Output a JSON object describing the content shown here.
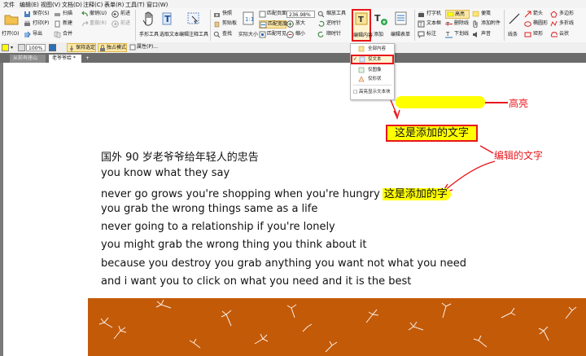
{
  "menu": {
    "items": [
      "文件",
      "编辑(E)",
      "视图(V)",
      "文档(D)",
      "注释(C)",
      "表单(R)",
      "工具(T)",
      "窗口(W)"
    ]
  },
  "ribbon": {
    "open": "打开(O)",
    "save_as": "保存(S)",
    "print": "打印(P)",
    "export": "导出",
    "scan": "扫描",
    "new": "新建",
    "merge": "合并",
    "undo": "撤销(U)",
    "redo": "重做(R)",
    "back": "前进",
    "forward": "前进",
    "hand_tool": "手形工具",
    "select_text": "选取文本",
    "edit_annot": "编辑注释工具",
    "snapshot": "快照",
    "clipboard": "剪贴板",
    "find": "查找",
    "actual_size": "实际大小",
    "fit_page": "匹配页面",
    "fit_width": "匹配宽度",
    "fit_visible": "匹配可见",
    "zoom_value": "236.98%",
    "zoom_in": "放大",
    "zoom_out": "缩小",
    "zoom_tool": "缩放工具",
    "rotate_left": "逆时针",
    "rotate_right": "顺时针",
    "edit_content": "编辑内容",
    "add": "添加",
    "edit_form": "编辑表单",
    "typewriter": "打字机",
    "textbox": "文本框",
    "callout": "标注",
    "highlight": "高亮",
    "strikeout": "删除线",
    "underline": "下划线",
    "note": "便笺",
    "attach": "添加附件",
    "sound": "声音",
    "line": "线条",
    "arrow": "箭头",
    "ellipse": "椭圆形",
    "rectangle": "矩形",
    "polygon": "多边形",
    "polyline": "多折线",
    "cloud": "云状"
  },
  "toolbar2": {
    "zoom": "100%",
    "keep_selected": "保持选定",
    "exclusive_mode": "独占模式",
    "properties": "属性(P)..."
  },
  "tabs": [
    {
      "label": "从前有座山"
    },
    {
      "label": "老爷爷给 *"
    }
  ],
  "dropdown": {
    "items": [
      "全部内容",
      "仅文本",
      "仅图像",
      "仅形状",
      "高亮显示文本块"
    ]
  },
  "document": {
    "lines": [
      "国外 90 岁老爷爷给年轻人的忠告",
      "you know what they say",
      "never go grows you're shopping when you're hungry",
      "you grab the wrong things same as a life",
      "never going to a relationship if you're lonely",
      "you might grab the wrong thing you think about it",
      "because you destroy you grab anything you want not what you need",
      "and i want you to click on what you need and it is the best"
    ],
    "inline_highlight": "这是添加的字",
    "added_text": "这是添加的文字"
  },
  "annotations": {
    "highlight_label": "高亮",
    "edit_text_label": "编辑的文字"
  },
  "colors": {
    "accent_red": "#e8161b",
    "highlight_yellow": "#ffff00",
    "banner_orange": "#c35a08"
  }
}
